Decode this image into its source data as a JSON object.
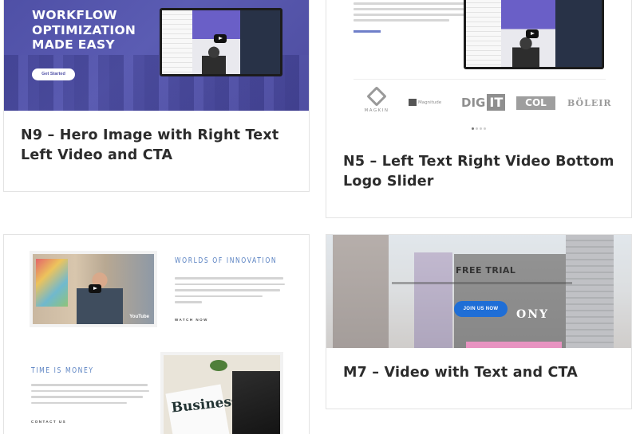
{
  "cards": [
    {
      "id": "n9",
      "title": "N9 – Hero Image with Right Text Left Video and CTA",
      "thumb": {
        "headline": "WORKFLOW OPTIMIZATION MADE EASY",
        "cta_label": "Get Started",
        "bg_color": "#5354a9"
      }
    },
    {
      "id": "n5",
      "title": "N5 – Left Text Right Video Bottom Logo Slider",
      "thumb": {
        "logos": [
          "MAGKIN",
          "Magnitude",
          "DIG",
          "IT",
          "COL",
          "BÖLEIR"
        ]
      }
    },
    {
      "id": "p3",
      "title": "",
      "thumb": {
        "heading_1": "WORLDS OF INNOVATION",
        "link_1": "WATCH NOW",
        "heading_2": "TIME IS MONEY",
        "link_2": "CONTACT US",
        "video_brand": "YouTube",
        "newspaper_word": "Business"
      }
    },
    {
      "id": "m7",
      "title": "M7 – Video with Text and CTA",
      "thumb": {
        "headline": "FREE TRIAL",
        "cta_label": "JOIN US NOW",
        "cta_color": "#1f6ed6",
        "sign_text": "ONY"
      }
    }
  ],
  "colors": {
    "title_text": "#2c2c2c",
    "card_border": "#e3e3e3",
    "accent_blue": "#5a82c2"
  }
}
